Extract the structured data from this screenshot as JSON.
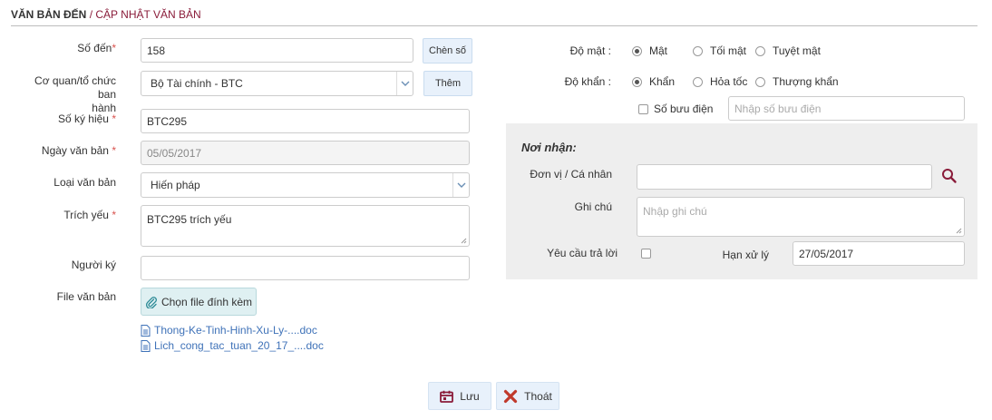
{
  "breadcrumb": {
    "parent": "VĂN BẢN ĐẾN",
    "separator": "/",
    "current": "CẬP NHẬT VĂN BẢN"
  },
  "form": {
    "so_den": {
      "label": "Số đến",
      "value": "158",
      "button": "Chèn số"
    },
    "co_quan": {
      "label_line1": "Cơ quan/tổ chức ban",
      "label_line2": "hành",
      "value": "Bộ Tài chính - BTC",
      "button": "Thêm"
    },
    "so_ky_hieu": {
      "label": "Số ký hiệu",
      "value": "BTC295"
    },
    "ngay_van_ban": {
      "label": "Ngày văn bản",
      "value": "05/05/2017"
    },
    "loai_van_ban": {
      "label": "Loại văn bản",
      "value": "Hiến pháp"
    },
    "trich_yeu": {
      "label": "Trích yếu",
      "value": "BTC295 trích yếu"
    },
    "nguoi_ky": {
      "label": "Người ký",
      "value": ""
    },
    "file_van_ban": {
      "label": "File văn bản",
      "button": "Chọn file đính kèm",
      "files": [
        "Thong-Ke-Tinh-Hinh-Xu-Ly-....doc",
        "Lich_cong_tac_tuan_20_17_....doc"
      ]
    },
    "required_mark": "*"
  },
  "security": {
    "do_mat": {
      "label": "Độ mật :",
      "options": [
        "Mật",
        "Tối mật",
        "Tuyệt mật"
      ],
      "selected": "Mật"
    },
    "do_khan": {
      "label": "Độ khẩn :",
      "options": [
        "Khẩn",
        "Hỏa tốc",
        "Thượng khẩn"
      ],
      "selected": "Khẩn"
    },
    "so_buu_dien": {
      "label": "Số bưu điện",
      "checked": false,
      "placeholder": "Nhập số bưu điện"
    }
  },
  "noi_nhan": {
    "title": "Nơi nhận:",
    "don_vi": {
      "label": "Đơn vị / Cá nhân",
      "value": ""
    },
    "ghi_chu": {
      "label": "Ghi chú",
      "placeholder": "Nhập ghi chú"
    },
    "yeu_cau_tra_loi": {
      "label": "Yêu cầu trả lời",
      "checked": false
    },
    "han_xu_ly": {
      "label": "Hạn xử lý",
      "value": "27/05/2017"
    }
  },
  "actions": {
    "save": "Lưu",
    "exit": "Thoát"
  },
  "colors": {
    "brand": "#8a1c3a",
    "link": "#3f72b8",
    "required": "#d9534f",
    "exit_icon": "#c0392b",
    "save_icon": "#8a1c3a"
  }
}
